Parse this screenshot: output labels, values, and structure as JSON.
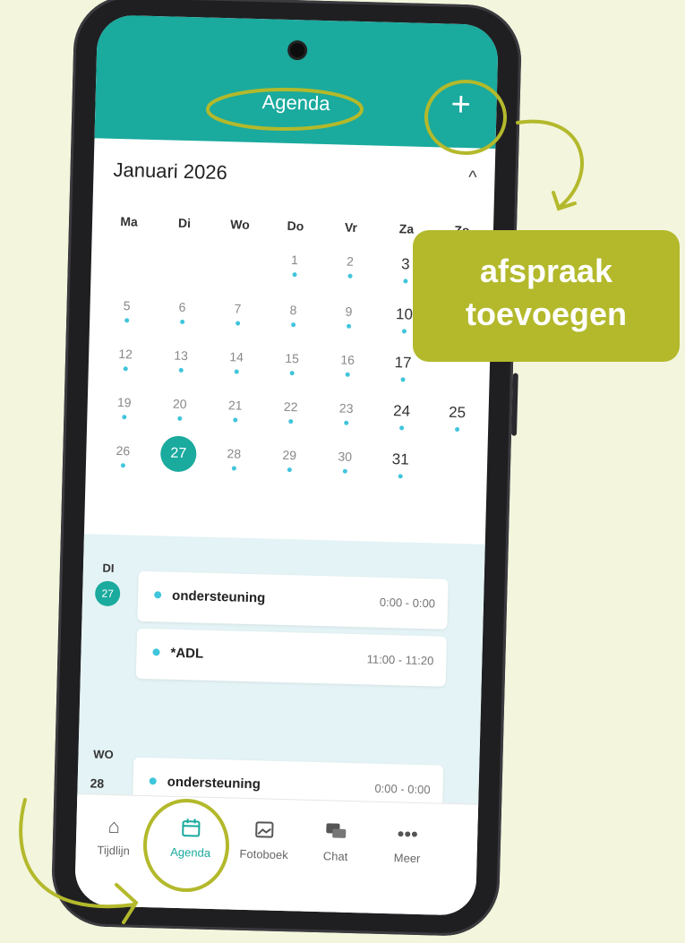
{
  "header": {
    "title": "Agenda",
    "add_button_label": "+"
  },
  "calendar": {
    "month_label": "Januari 2026",
    "collapse_icon": "chevron-up-icon",
    "weekdays": [
      "Ma",
      "Di",
      "Wo",
      "Do",
      "Vr",
      "Za",
      "Zo"
    ],
    "days": [
      "1",
      "2",
      "3",
      "5",
      "6",
      "7",
      "8",
      "9",
      "10",
      "12",
      "13",
      "14",
      "15",
      "16",
      "17",
      "19",
      "20",
      "21",
      "22",
      "23",
      "24",
      "25",
      "26",
      "27",
      "28",
      "29",
      "30",
      "31"
    ],
    "selected_day": "27"
  },
  "agenda": {
    "groups": [
      {
        "weekday": "DI",
        "day": "27",
        "events": [
          {
            "title": "ondersteuning",
            "time": "0:00 - 0:00"
          },
          {
            "title": "*ADL",
            "time": "11:00 - 11:20"
          }
        ]
      },
      {
        "weekday": "WO",
        "day": "28",
        "events": [
          {
            "title": "ondersteuning",
            "time": "0:00 - 0:00"
          }
        ]
      }
    ]
  },
  "tabs": [
    {
      "label": "Tijdlijn",
      "icon": "home-icon"
    },
    {
      "label": "Agenda",
      "icon": "calendar-icon",
      "active": true
    },
    {
      "label": "Fotoboek",
      "icon": "image-icon"
    },
    {
      "label": "Chat",
      "icon": "chat-icon"
    },
    {
      "label": "Meer",
      "icon": "more-icon"
    }
  ],
  "callout": {
    "line1": "afspraak",
    "line2": "toevoegen"
  },
  "colors": {
    "teal": "#1aaa9e",
    "accent_green": "#b3b92b",
    "dot_blue": "#3fc5dc",
    "background": "#f3f5dd"
  }
}
